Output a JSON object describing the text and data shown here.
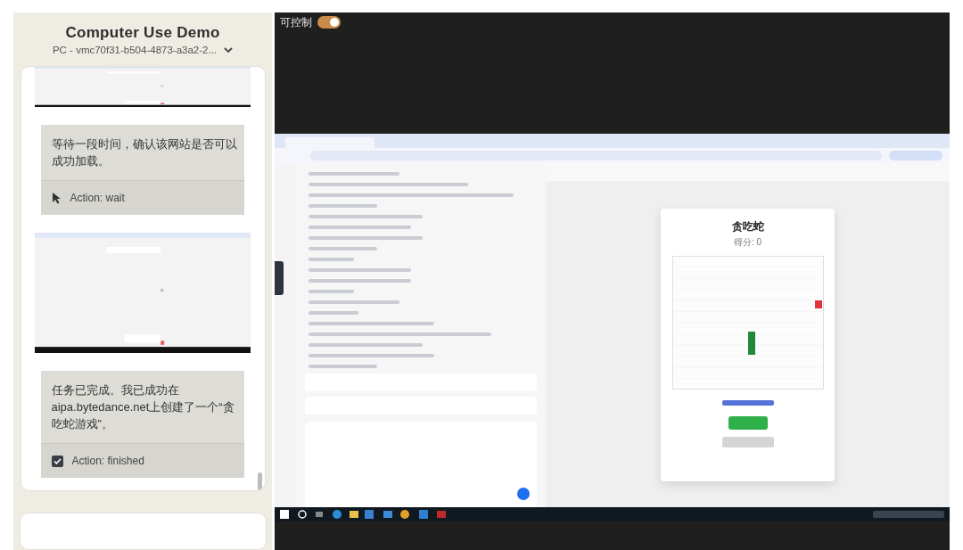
{
  "app": {
    "title": "Computer Use Demo",
    "machine": "PC - vmc70f31-b504-4873-a3a2-2..."
  },
  "steps": [
    {
      "kind": "screenshot"
    },
    {
      "kind": "message",
      "text": "等待一段时间，确认该网站是否可以成功加载。",
      "action": {
        "kind": "cursor",
        "label": "Action: wait"
      }
    },
    {
      "kind": "screenshot"
    },
    {
      "kind": "message",
      "text": "任务已完成。我已成功在aipa.bytedance.net上创建了一个“贪吃蛇游戏”。",
      "action": {
        "kind": "check",
        "label": "Action: finished"
      }
    }
  ],
  "control": {
    "label": "可控制",
    "on": true
  },
  "remote": {
    "game_title": "贪吃蛇",
    "score": "得分: 0"
  }
}
